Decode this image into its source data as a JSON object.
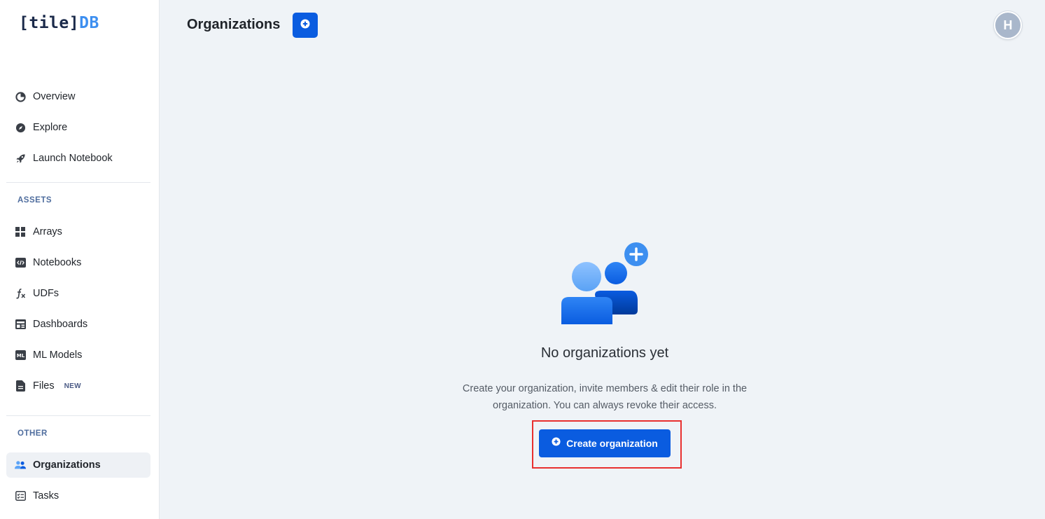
{
  "logo": {
    "bracket_open": "[",
    "tile": "tile",
    "bracket_close": "]",
    "db": "DB"
  },
  "sidebar": {
    "main_items": [
      {
        "label": "Overview",
        "icon": "pie-chart-icon"
      },
      {
        "label": "Explore",
        "icon": "compass-icon"
      },
      {
        "label": "Launch Notebook",
        "icon": "rocket-icon"
      }
    ],
    "assets_title": "ASSETS",
    "assets_items": [
      {
        "label": "Arrays",
        "icon": "grid-icon"
      },
      {
        "label": "Notebooks",
        "icon": "code-notebook-icon"
      },
      {
        "label": "UDFs",
        "icon": "function-icon"
      },
      {
        "label": "Dashboards",
        "icon": "dashboard-icon"
      },
      {
        "label": "ML Models",
        "icon": "ml-icon"
      },
      {
        "label": "Files",
        "icon": "file-icon",
        "badge": "NEW"
      }
    ],
    "other_title": "OTHER",
    "other_items": [
      {
        "label": "Organizations",
        "icon": "users-icon",
        "active": true
      },
      {
        "label": "Tasks",
        "icon": "tasks-icon"
      }
    ]
  },
  "header": {
    "title": "Organizations",
    "avatar_initial": "H"
  },
  "empty_state": {
    "title": "No organizations yet",
    "description_line1": "Create your organization, invite members & edit their role in the",
    "description_line2": "organization. You can always revoke their access.",
    "button_label": "Create organization"
  },
  "colors": {
    "accent": "#0a5ce0",
    "highlight_border": "#e8302f",
    "logo_db": "#3d8ff0"
  }
}
